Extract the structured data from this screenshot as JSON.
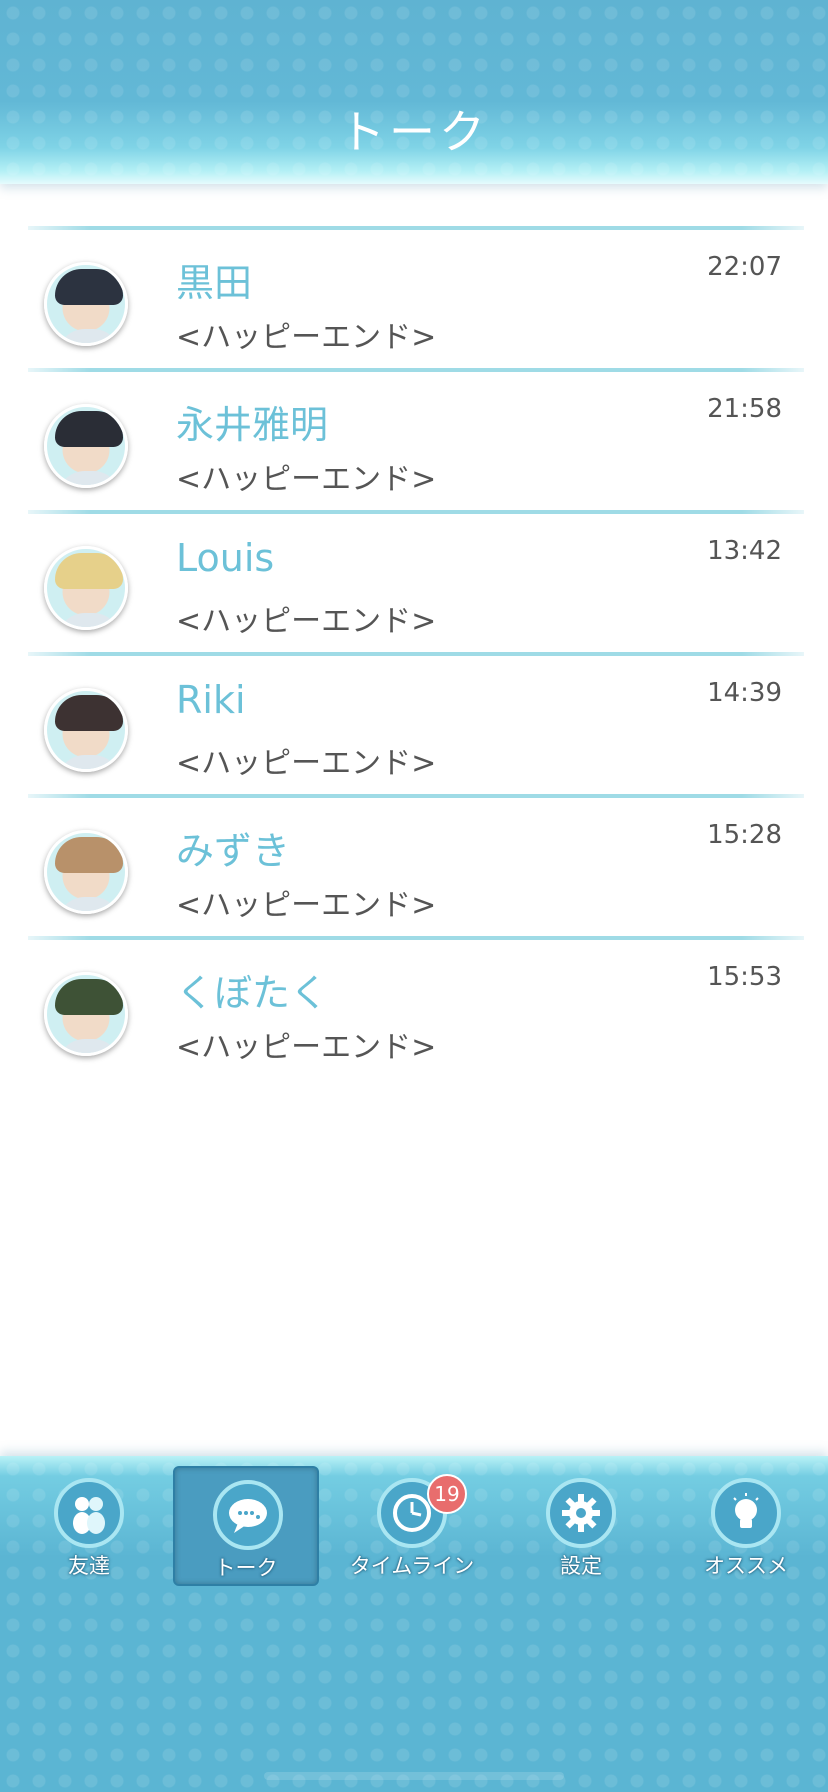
{
  "header": {
    "title": "トーク"
  },
  "chats": [
    {
      "name": "黒田",
      "preview": "<ハッピーエンド>",
      "time": "22:07",
      "hair": "#2c3340"
    },
    {
      "name": "永井雅明",
      "preview": "<ハッピーエンド>",
      "time": "21:58",
      "hair": "#2a2d36"
    },
    {
      "name": "Louis",
      "preview": "<ハッピーエンド>",
      "time": "13:42",
      "hair": "#e6d08a"
    },
    {
      "name": "Riki",
      "preview": "<ハッピーエンド>",
      "time": "14:39",
      "hair": "#3d3232"
    },
    {
      "name": "みずき",
      "preview": "<ハッピーエンド>",
      "time": "15:28",
      "hair": "#b8916a"
    },
    {
      "name": "くぼたく",
      "preview": "<ハッピーエンド>",
      "time": "15:53",
      "hair": "#3e5236"
    }
  ],
  "nav": {
    "items": [
      {
        "label": "友達",
        "icon": "friends-icon"
      },
      {
        "label": "トーク",
        "icon": "chat-bubble-icon",
        "active": true
      },
      {
        "label": "タイムライン",
        "icon": "clock-icon",
        "badge": "19"
      },
      {
        "label": "設定",
        "icon": "gear-icon"
      },
      {
        "label": "オススメ",
        "icon": "lightbulb-icon"
      }
    ]
  },
  "colors": {
    "accent": "#6cc1d8",
    "header": "#5fb3d2",
    "badge": "#e86d6d"
  }
}
